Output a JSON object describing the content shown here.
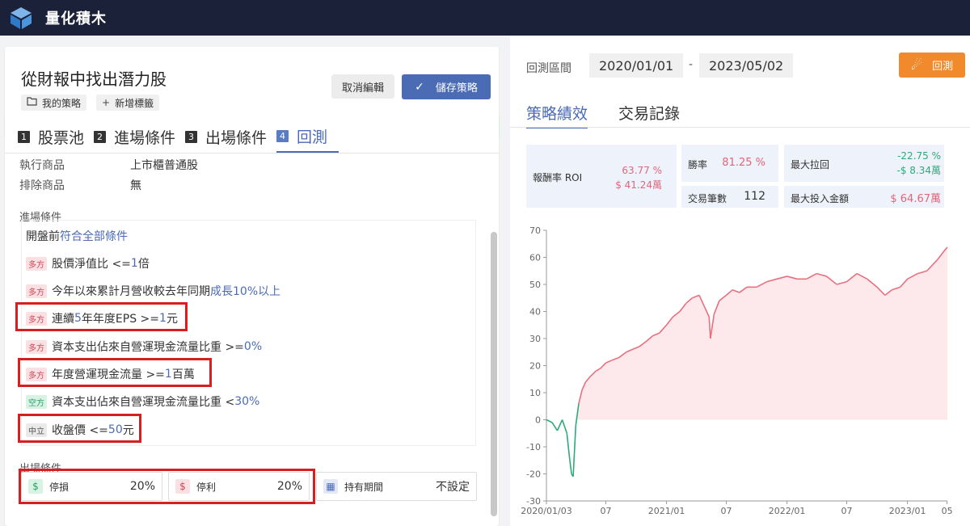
{
  "app": {
    "brand": "量化積木"
  },
  "strategy": {
    "title": "從財報中找出潛力股",
    "tags": [
      {
        "icon": "folder-icon",
        "label": "我的策略"
      },
      {
        "icon": "plus-icon",
        "label": "新增標籤"
      }
    ],
    "cancel_label": "取消編輯",
    "save_label": "儲存策略"
  },
  "steps": [
    {
      "num": "1",
      "label": "股票池"
    },
    {
      "num": "2",
      "label": "進場條件"
    },
    {
      "num": "3",
      "label": "出場條件"
    },
    {
      "num": "4",
      "label": "回測"
    }
  ],
  "summary": {
    "exec_label": "執行商品",
    "exec_value": "上市櫃普通股",
    "exclude_label": "排除商品",
    "exclude_value": "無"
  },
  "entry": {
    "section_title": "進場條件",
    "header_prefix": "開盤前",
    "header_link": "符合全部條件",
    "conditions": [
      {
        "badge": "多方",
        "pre": "股價淨值比 <= ",
        "val": "1",
        "post": "倍"
      },
      {
        "badge": "多方",
        "pre": "今年以來累計月營收較去年同期",
        "val": "成長10%以上",
        "post": ""
      },
      {
        "badge": "多方",
        "pre": "連續",
        "val": "5",
        "post": "年年度EPS >= ",
        "val2": "1",
        "post2": "元"
      },
      {
        "badge": "多方",
        "pre": "資本支出佔來自營運現金流量比重 >= ",
        "val": "0%",
        "post": ""
      },
      {
        "badge": "多方",
        "pre": "年度營運現金流量 >= ",
        "val": "1",
        "post": "百萬"
      },
      {
        "badge": "空方",
        "pre": "資本支出佔來自營運現金流量比重 < ",
        "val": "30%",
        "post": ""
      },
      {
        "badge": "中立",
        "pre": "收盤價 <= ",
        "val": "50",
        "post": "元"
      }
    ]
  },
  "exit": {
    "section_title": "出場條件",
    "stop_loss": {
      "label": "停損",
      "value": "20%"
    },
    "take_profit": {
      "label": "停利",
      "value": "20%"
    },
    "holding": {
      "label": "持有期間",
      "value": "不設定"
    }
  },
  "backtest": {
    "range_label": "回測區間",
    "start_date": "2020/01/01",
    "separator": "-",
    "end_date": "2023/05/02",
    "run_label": "回測",
    "tabs": [
      "策略績效",
      "交易記錄"
    ],
    "stats": {
      "roi_label": "報酬率 ROI",
      "roi_pct": "63.77 %",
      "roi_amt": "$ 41.24萬",
      "win_label": "勝率",
      "win_value": "81.25 %",
      "dd_label": "最大拉回",
      "dd_pct": "-22.75 %",
      "dd_amt": "-$ 8.34萬",
      "trades_label": "交易筆數",
      "trades_value": "112",
      "maxinv_label": "最大投入金額",
      "maxinv_value": "$ 64.67萬"
    }
  },
  "chart_data": {
    "type": "area",
    "ylim": [
      -30,
      70
    ],
    "yticks": [
      70,
      60,
      50,
      40,
      30,
      20,
      10,
      0,
      -10,
      -20,
      -30
    ],
    "xtick_labels": [
      "2020/01/03",
      "07",
      "2021/01",
      "07",
      "2022/01",
      "07",
      "2023/01",
      "05"
    ],
    "xtick_dates": [
      "2020-01-03",
      "2020-07-01",
      "2021-01-01",
      "2021-07-01",
      "2022-01-01",
      "2022-07-01",
      "2023-01-01",
      "2023-05-01"
    ],
    "positive_color": "#e8707e",
    "negative_color": "#2eaa7a",
    "fill_color": "#fde8ec",
    "series": [
      {
        "x": [
          "2020-01-03",
          "2020-01-20",
          "2020-02-05",
          "2020-02-20",
          "2020-03-05",
          "2020-03-12",
          "2020-03-19",
          "2020-03-24",
          "2020-04-01",
          "2020-04-10",
          "2020-04-20",
          "2020-05-01",
          "2020-05-15",
          "2020-06-01",
          "2020-06-15",
          "2020-07-01",
          "2020-07-20",
          "2020-08-10",
          "2020-09-01",
          "2020-09-20",
          "2020-10-10",
          "2020-11-01",
          "2020-11-20",
          "2020-12-10",
          "2021-01-01",
          "2021-01-20",
          "2021-02-10",
          "2021-03-01",
          "2021-03-20",
          "2021-04-10",
          "2021-04-25",
          "2021-05-10",
          "2021-05-14",
          "2021-05-25",
          "2021-06-10",
          "2021-07-01",
          "2021-07-20",
          "2021-08-10",
          "2021-09-01",
          "2021-10-01",
          "2021-11-01",
          "2021-12-01",
          "2022-01-01",
          "2022-02-01",
          "2022-03-01",
          "2022-04-01",
          "2022-05-01",
          "2022-06-01",
          "2022-07-01",
          "2022-08-01",
          "2022-09-01",
          "2022-10-01",
          "2022-10-25",
          "2022-11-15",
          "2022-12-10",
          "2023-01-01",
          "2023-02-01",
          "2023-03-01",
          "2023-04-01",
          "2023-04-20",
          "2023-05-02"
        ],
        "y": [
          0,
          -1,
          -4,
          0,
          -5,
          -13,
          -20,
          -21,
          -2,
          6,
          11,
          14,
          16,
          18,
          19,
          21,
          22,
          23,
          25,
          26,
          27,
          29,
          31,
          32,
          35,
          38,
          40,
          43,
          45,
          46,
          42,
          38,
          30,
          39,
          44,
          46,
          48,
          47,
          49,
          49,
          51,
          52,
          53,
          52,
          52,
          54,
          53,
          50,
          51,
          54,
          52,
          49,
          46,
          48,
          49,
          52,
          54,
          55,
          59,
          62,
          63.77
        ]
      }
    ]
  }
}
